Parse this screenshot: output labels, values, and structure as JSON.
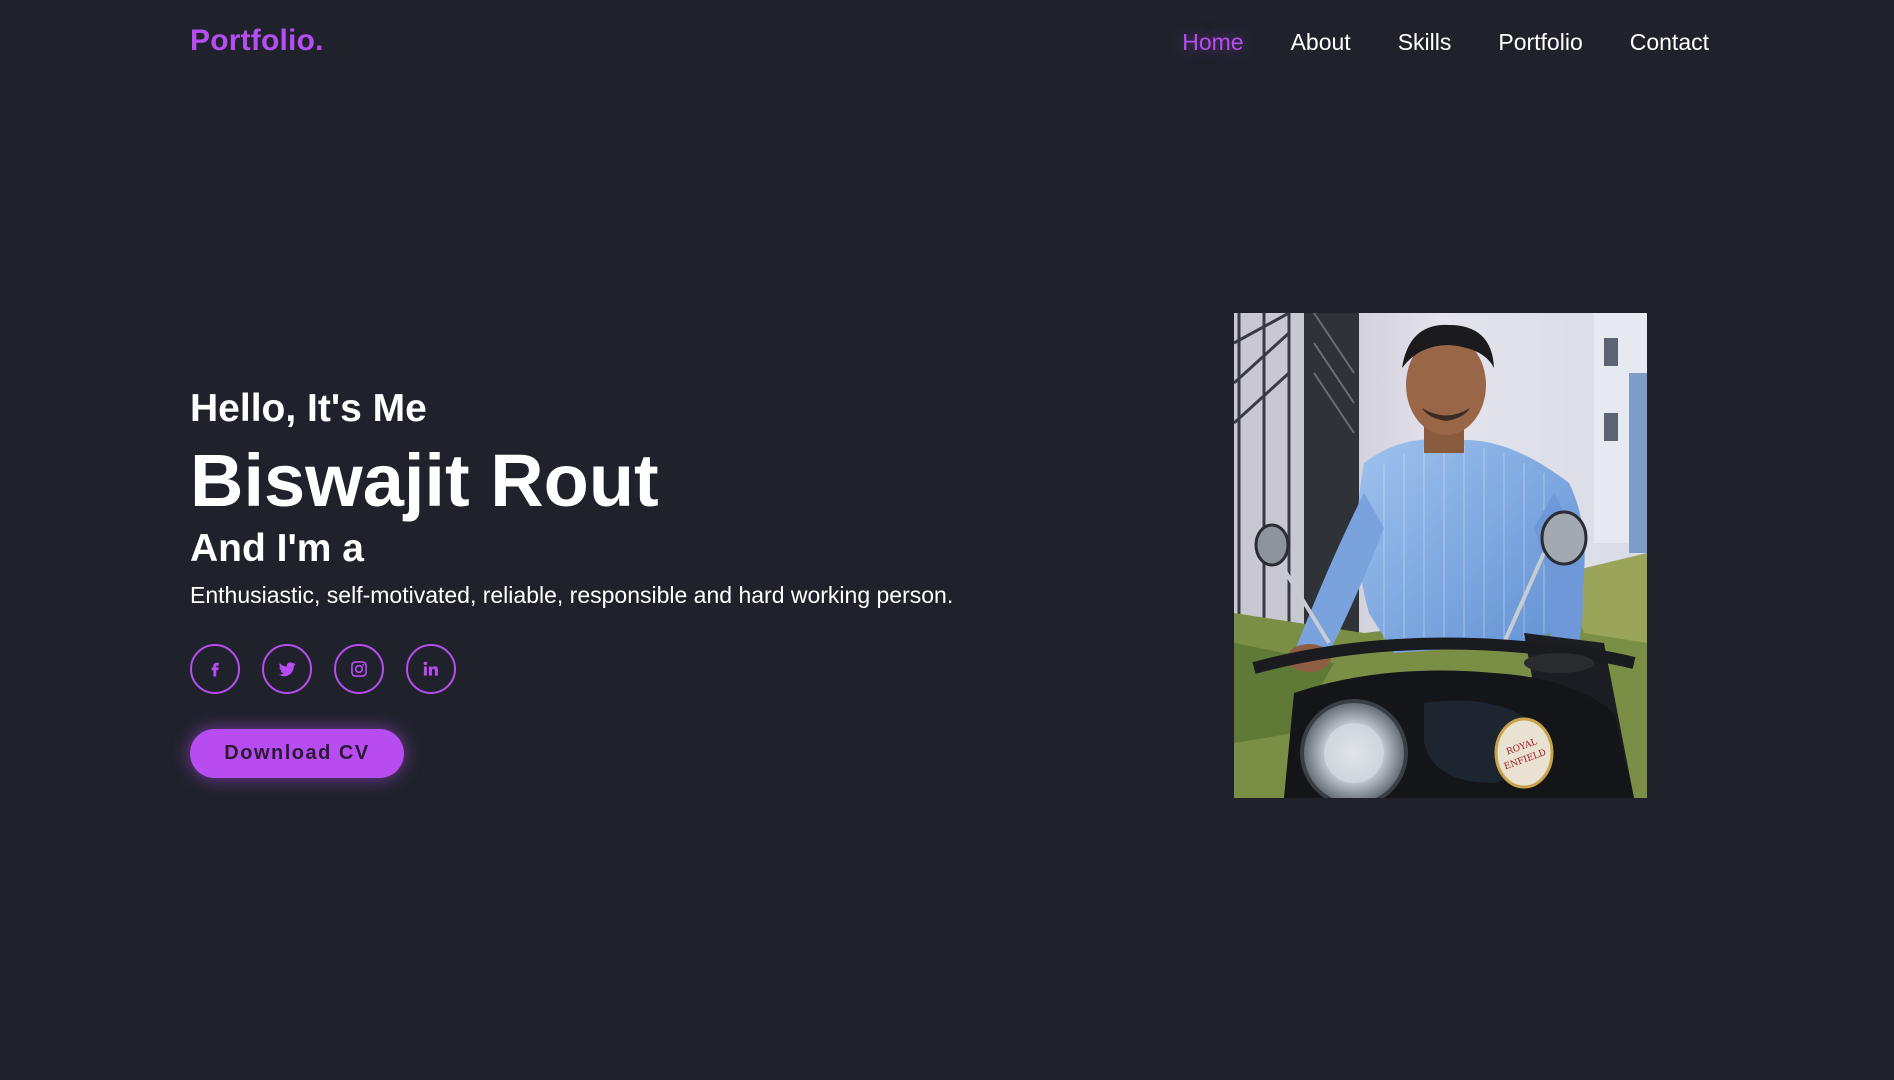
{
  "header": {
    "logo": "Portfolio.",
    "nav": [
      {
        "label": "Home",
        "active": true
      },
      {
        "label": "About",
        "active": false
      },
      {
        "label": "Skills",
        "active": false
      },
      {
        "label": "Portfolio",
        "active": false
      },
      {
        "label": "Contact",
        "active": false
      }
    ]
  },
  "hero": {
    "greeting": "Hello, It's Me",
    "name": "Biswajit Rout",
    "role_intro": "And I'm a",
    "description": "Enthusiastic, self-motivated, reliable, responsible and hard working person.",
    "socials": [
      {
        "icon": "facebook-icon",
        "glyph": "f"
      },
      {
        "icon": "twitter-icon"
      },
      {
        "icon": "instagram-icon"
      },
      {
        "icon": "linkedin-icon",
        "glyph": "in"
      }
    ],
    "cta_label": "Download CV"
  },
  "profile_photo": {
    "badge_text": "ROYAL ENFIELD"
  },
  "colors": {
    "background": "#1f222b",
    "accent": "#b74df0",
    "text": "#ffffff"
  }
}
